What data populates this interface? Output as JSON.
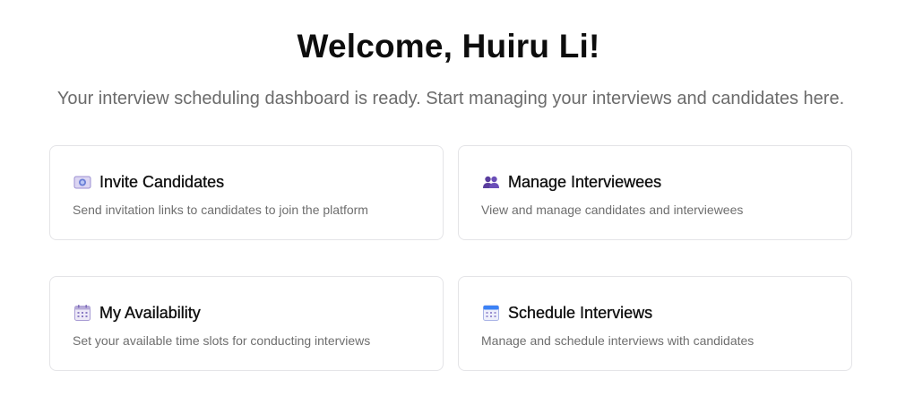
{
  "header": {
    "title": "Welcome, Huiru Li!",
    "subtitle": "Your interview scheduling dashboard is ready. Start managing your interviews and candidates here."
  },
  "cards": [
    {
      "icon": "invitation-icon",
      "title": "Invite Candidates",
      "description": "Send invitation links to candidates to join the platform"
    },
    {
      "icon": "people-icon",
      "title": "Manage Interviewees",
      "description": "View and manage candidates and interviewees"
    },
    {
      "icon": "calendar-icon",
      "title": "My Availability",
      "description": "Set your available time slots for conducting interviews"
    },
    {
      "icon": "schedule-calendar-icon",
      "title": "Schedule Interviews",
      "description": "Manage and schedule interviews with candidates"
    }
  ],
  "colors": {
    "card_border": "#e4e4e7",
    "subtitle": "#6b6b6b",
    "description": "#6e6e6e",
    "icon_purple": "#6b4fb8",
    "icon_blue": "#3b82f6"
  }
}
